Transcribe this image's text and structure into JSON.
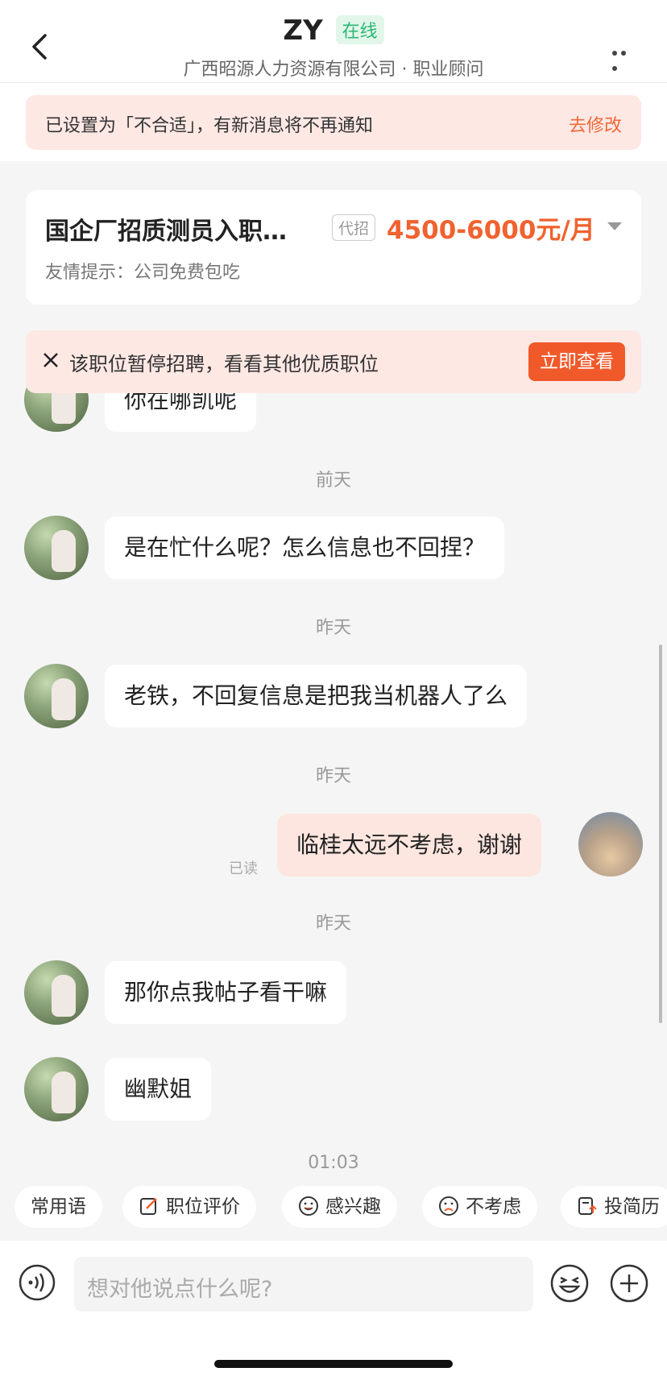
{
  "header": {
    "name": "ZY",
    "status": "在线",
    "subtitle": "广西昭源人力资源有限公司 · 职业顾问"
  },
  "notice": {
    "text": "已设置为「不合适」，有新消息将不再通知",
    "action": "去修改"
  },
  "job": {
    "title": "国企厂招质测员入职…",
    "tag": "代招",
    "salary": "4500-6000元/月",
    "hint": "友情提示：公司免费包吃"
  },
  "paused": {
    "text": "该职位暂停招聘，看看其他优质职位",
    "button": "立即查看"
  },
  "messages": {
    "m0": "你在哪凯呢",
    "t1": "前天",
    "m1": "是在忙什么呢？怎么信息也不回捏？",
    "t2": "昨天",
    "m2": "老铁，不回复信息是把我当机器人了么",
    "t3": "昨天",
    "m3": "临桂太远不考虑，谢谢",
    "m3_status": "已读",
    "t4": "昨天",
    "m4": "那你点我帖子看干嘛",
    "m5": "幽默姐",
    "t5": "01:03"
  },
  "quick_replies": [
    "常用语",
    "职位评价",
    "感兴趣",
    "不考虑",
    "投简历"
  ],
  "input": {
    "placeholder": "想对他说点什么呢?"
  },
  "colors": {
    "accent": "#f05a2a",
    "notice_bg": "#fde8e4",
    "online": "#2bb673"
  }
}
